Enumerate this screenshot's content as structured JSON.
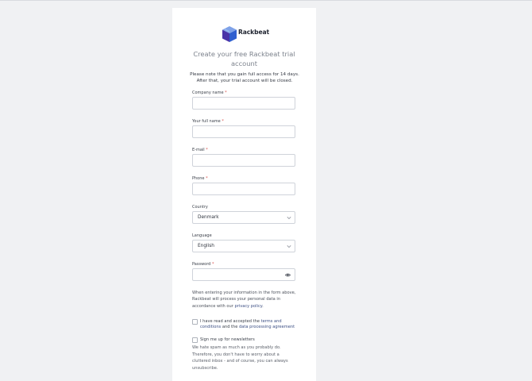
{
  "brand": {
    "name": "Rackbeat"
  },
  "heading": {
    "title": "Create your free Rackbeat trial account",
    "notice_line1": "Please note that you gain full access for 14 days.",
    "notice_line2": "After that, your trial account will be closed."
  },
  "form": {
    "company": {
      "label": "Company name",
      "required": "*",
      "value": ""
    },
    "fullname": {
      "label": "Your full name",
      "required": "*",
      "value": ""
    },
    "email": {
      "label": "E-mail",
      "required": "*",
      "value": ""
    },
    "phone": {
      "label": "Phone",
      "required": "*",
      "value": ""
    },
    "country": {
      "label": "Country",
      "selected": "Denmark"
    },
    "language": {
      "label": "Language",
      "selected": "English"
    },
    "password": {
      "label": "Password",
      "required": "*",
      "value": ""
    }
  },
  "privacy": {
    "text": "When entering your information in the form above, Rackbeat will process your personal data in accordance with our",
    "link": "privacy policy",
    "end": "."
  },
  "terms": {
    "prefix": "I have read and accepted the",
    "terms_link": "terms and conditions",
    "middle": "and the",
    "dpa_link": "data processing agreement",
    "checked": false
  },
  "newsletter": {
    "label": "Sign me up for newsletters",
    "description": "We hate spam as much as you probably do. Therefore, you don't have to worry about a cluttered inbox - and of course, you can always unsubscribe.",
    "checked": false
  },
  "colors": {
    "brand_purple": "#5b3fb0",
    "link": "#3c4f84",
    "required": "#d9534f"
  },
  "icons": {
    "logo": "rackbeat-cube-logo",
    "select": "chevron-down-icon",
    "password": "eye-icon"
  }
}
